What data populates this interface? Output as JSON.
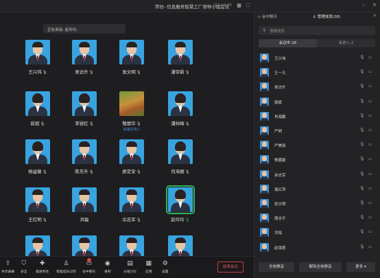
{
  "window": {
    "title": "常坊-·信息服务智慧工厂领导小组会议",
    "timer": "01:13:45"
  },
  "stage": {
    "speaking_prefix": "正在讲话:",
    "speaking_name": "赵玲玲;"
  },
  "participants_grid": [
    {
      "name": "王兴伟",
      "mic": "muted"
    },
    {
      "name": "吴访升",
      "mic": "muted"
    },
    {
      "name": "张文明",
      "mic": "muted"
    },
    {
      "name": "潘帝新",
      "mic": "muted"
    },
    {
      "name": "宸斌",
      "mic": "muted"
    },
    {
      "name": "李锐红",
      "mic": "muted"
    },
    {
      "name": "敬丽华",
      "mic": "muted",
      "sub": "会議主持人"
    },
    {
      "name": "潘帅梅",
      "mic": "muted"
    },
    {
      "name": "杨益敏",
      "mic": "muted"
    },
    {
      "name": "陈东升",
      "mic": "muted"
    },
    {
      "name": "廖定安",
      "mic": "muted"
    },
    {
      "name": "肖海丽",
      "mic": "muted"
    },
    {
      "name": "王红明",
      "mic": "muted"
    },
    {
      "name": "洪磊",
      "mic": "none"
    },
    {
      "name": "佘志军",
      "mic": "muted"
    },
    {
      "name": "赵玲玲",
      "mic": "active"
    },
    {
      "name": "",
      "mic": "none"
    },
    {
      "name": "",
      "mic": "none"
    },
    {
      "name": "",
      "mic": "none"
    },
    {
      "name": "",
      "mic": "none"
    }
  ],
  "toolbar": {
    "items": [
      {
        "label": "共享屏幕",
        "icon": "share-screen-icon"
      },
      {
        "label": "安全",
        "icon": "shield-icon"
      },
      {
        "label": "邀请参会",
        "icon": "invite-icon"
      },
      {
        "label": "管理成员(28)",
        "icon": "members-icon"
      },
      {
        "label": "会中聊天",
        "icon": "chat-icon"
      },
      {
        "label": "录制",
        "icon": "record-icon"
      },
      {
        "label": "分组讨论",
        "icon": "breakout-icon"
      },
      {
        "label": "应用",
        "icon": "apps-icon"
      },
      {
        "label": "设置",
        "icon": "settings-icon"
      }
    ],
    "leave_label": "结束会议"
  },
  "panel": {
    "tab_chat": "会中聊天",
    "tab_members": "管理成员(28)",
    "search_placeholder": "搜索成员",
    "seg_in": "会议中·28",
    "seg_out": "未进入·2",
    "members": [
      "王兴伟",
      "王一凡",
      "吴访升",
      "宸斌",
      "肖海鹏",
      "严明",
      "严美丽",
      "杨嘉敏",
      "余志军",
      "袁红萍",
      "张文明",
      "周志平",
      "洪海",
      "赵锦勇"
    ],
    "footer": {
      "mute_all": "全体静音",
      "unmute_all": "解除全体静音",
      "more": "更多"
    }
  },
  "colors": {
    "accent": "#3a8fd4",
    "active_speaker": "#2fb35a",
    "danger": "#d23c3c"
  }
}
